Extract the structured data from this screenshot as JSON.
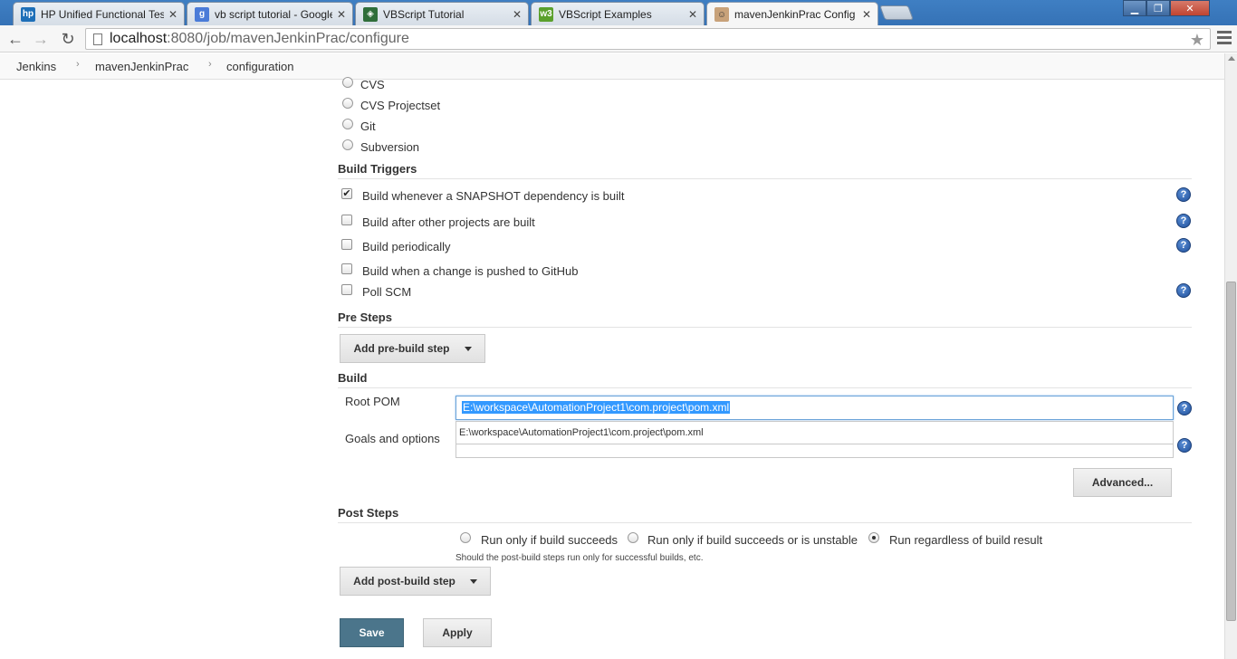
{
  "browser": {
    "tabs": [
      {
        "title": "HP Unified Functional Tes",
        "fav_color": "#1d6fb8",
        "fav_glyph": "hp"
      },
      {
        "title": "vb script tutorial - Google",
        "fav_color": "#4a7bd8",
        "fav_glyph": "g"
      },
      {
        "title": "VBScript Tutorial",
        "fav_color": "#2f6e3a",
        "fav_glyph": "◈"
      },
      {
        "title": "VBScript Examples",
        "fav_color": "#5aa02c",
        "fav_glyph": "w3"
      },
      {
        "title": "mavenJenkinPrac Config [",
        "fav_color": "#c8a27a",
        "fav_glyph": "☺"
      }
    ],
    "close_glyph": "✕",
    "url_host": "localhost",
    "url_path": ":8080/job/mavenJenkinPrac/configure"
  },
  "breadcrumbs": {
    "items": [
      "Jenkins",
      "mavenJenkinPrac",
      "configuration"
    ],
    "separator": "›"
  },
  "scm": {
    "options": [
      "CVS",
      "CVS Projectset",
      "Git",
      "Subversion"
    ]
  },
  "build_triggers": {
    "title": "Build Triggers",
    "items": [
      {
        "label": "Build whenever a SNAPSHOT dependency is built",
        "checked": true
      },
      {
        "label": "Build after other projects are built",
        "checked": false
      },
      {
        "label": "Build periodically",
        "checked": false
      },
      {
        "label": "Build when a change is pushed to GitHub",
        "checked": false
      },
      {
        "label": "Poll SCM",
        "checked": false
      }
    ]
  },
  "pre_steps": {
    "title": "Pre Steps",
    "add_button": "Add pre-build step"
  },
  "build": {
    "title": "Build",
    "root_pom_label": "Root POM",
    "root_pom_value": "E:\\workspace\\AutomationProject1\\com.project\\pom.xml",
    "autocomplete_suggestion": "E:\\workspace\\AutomationProject1\\com.project\\pom.xml",
    "goals_label": "Goals and options",
    "goals_value": "",
    "advanced_button": "Advanced..."
  },
  "post_steps": {
    "title": "Post Steps",
    "options": [
      {
        "label": "Run only if build succeeds",
        "selected": false
      },
      {
        "label": "Run only if build succeeds or is unstable",
        "selected": false
      },
      {
        "label": "Run regardless of build result",
        "selected": true
      }
    ],
    "hint": "Should the post-build steps run only for successful builds, etc.",
    "add_button": "Add post-build step"
  },
  "actions": {
    "save": "Save",
    "apply": "Apply"
  },
  "help_glyph": "?",
  "colors": {
    "save_button": "#4b758b",
    "selection": "#3399ff",
    "help_icon": "#2a5db0"
  }
}
